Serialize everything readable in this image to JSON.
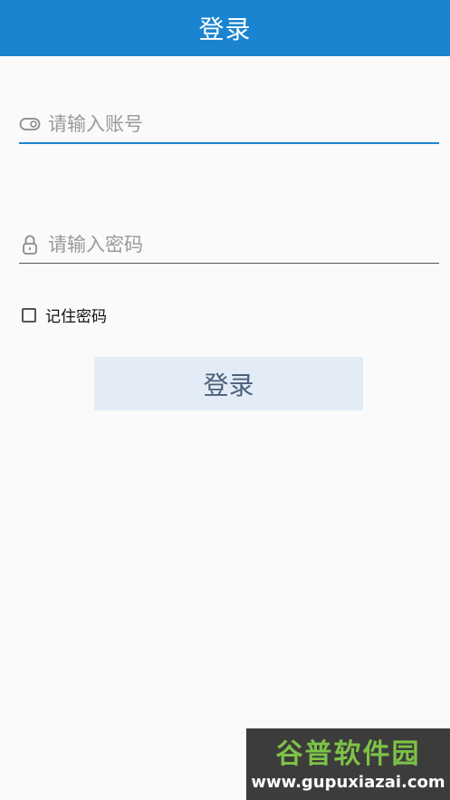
{
  "header": {
    "title": "登录",
    "background_color": "#1a84d0"
  },
  "form": {
    "account": {
      "icon": "toggle-icon",
      "placeholder": "请输入账号",
      "value": ""
    },
    "password": {
      "icon": "lock-icon",
      "placeholder": "请输入密码",
      "value": ""
    },
    "remember": {
      "label": "记住密码",
      "checked": false
    },
    "login_button_label": "登录"
  },
  "watermark": {
    "logo": "谷普软件园",
    "url": "www.gupuxiazai.com"
  }
}
